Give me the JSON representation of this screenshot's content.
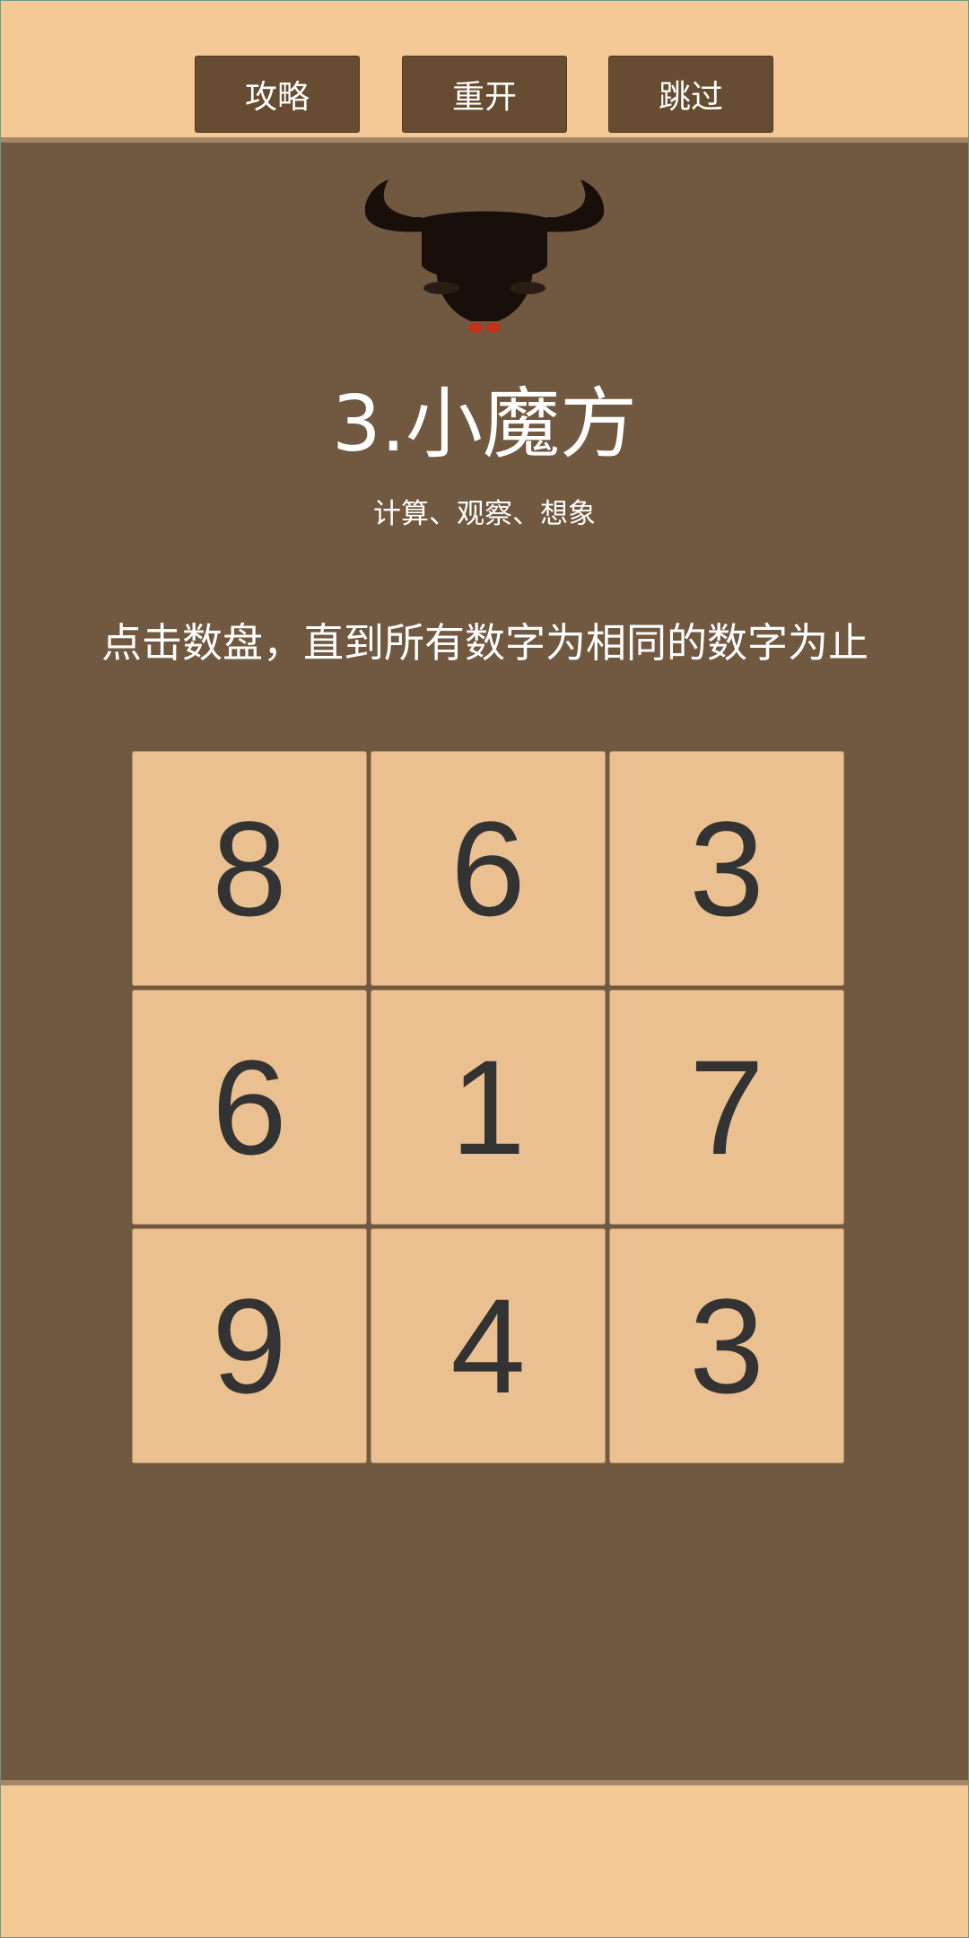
{
  "toolbar": {
    "guide_label": "攻略",
    "restart_label": "重开",
    "skip_label": "跳过"
  },
  "level": {
    "title": "3.小魔方",
    "subtitle": "计算、观察、想象",
    "instruction": "点击数盘，直到所有数字为相同的数字为止"
  },
  "grid": {
    "cells": [
      "8",
      "6",
      "3",
      "6",
      "1",
      "7",
      "9",
      "4",
      "3"
    ]
  },
  "icons": {
    "mascot": "bull-head-icon"
  },
  "colors": {
    "page_background": "#f5c995",
    "stage_background": "#705841",
    "button_background": "#664c30",
    "tile_background": "#ebc090",
    "tile_text": "#333333",
    "bull_eyes": "#c0341b"
  }
}
